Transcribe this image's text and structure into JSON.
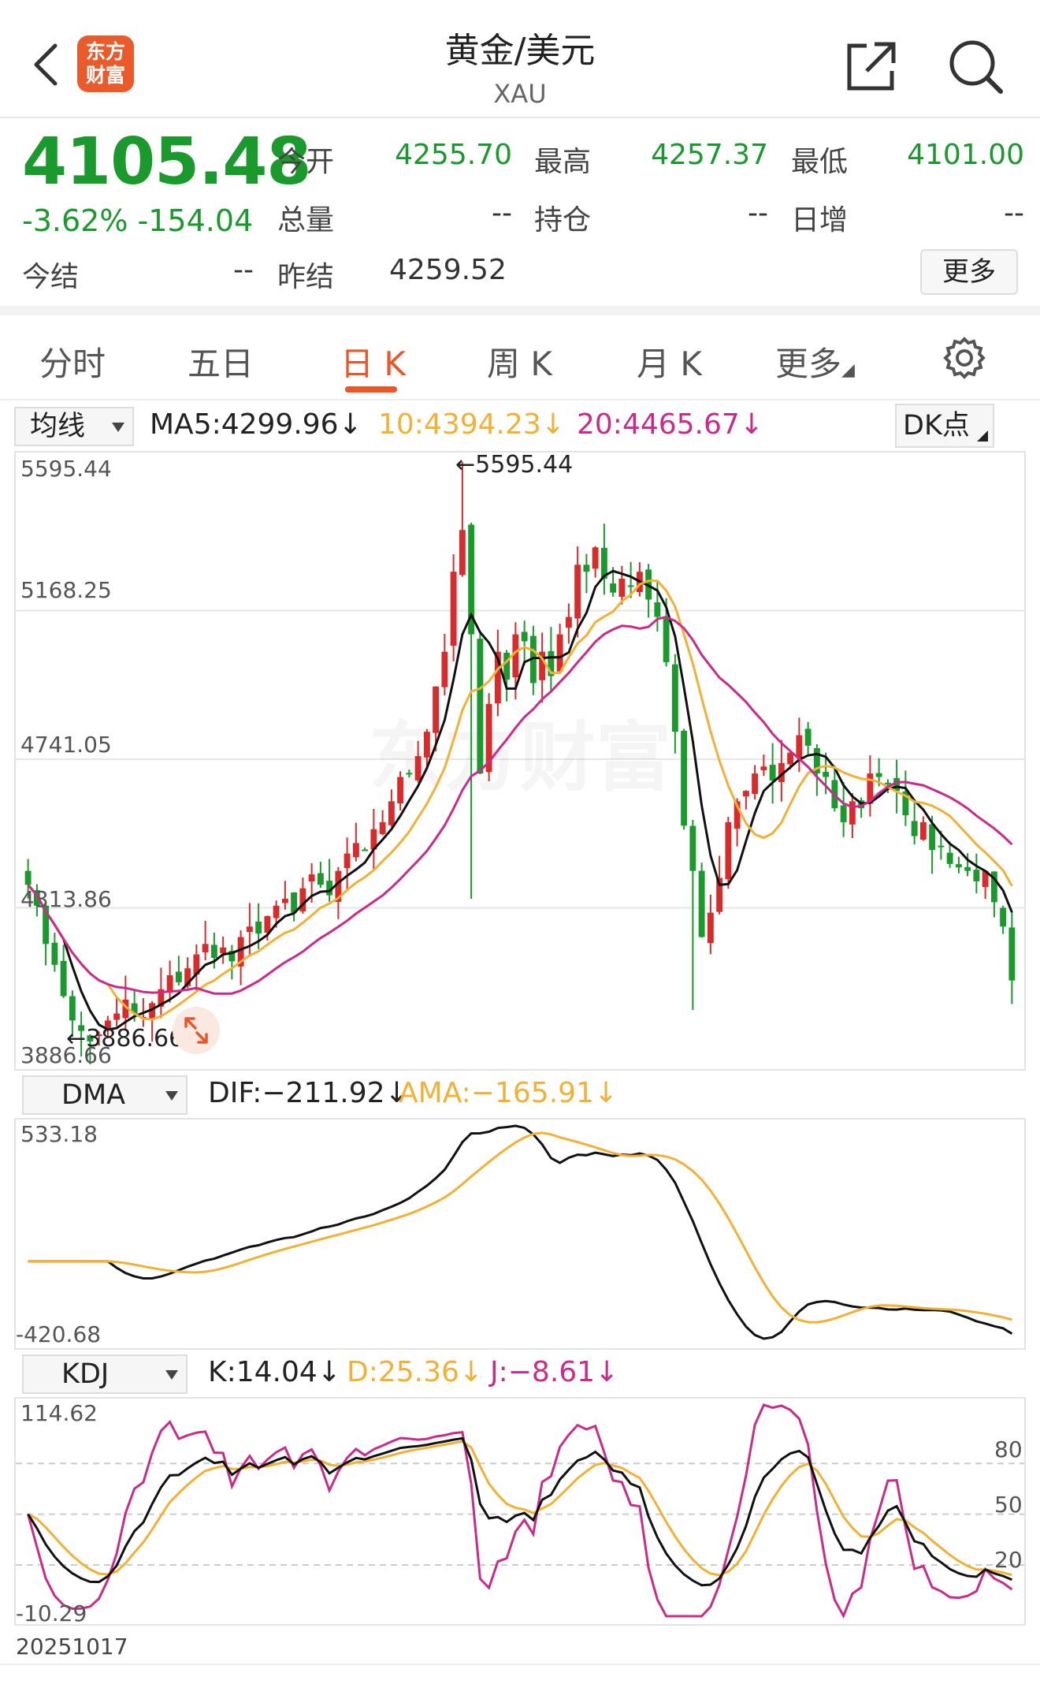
{
  "header": {
    "title": "黄金/美元",
    "subtitle": "XAU",
    "logo_text_1": "东方",
    "logo_text_2": "财富"
  },
  "quote": {
    "price": "4105.48",
    "change_pct": "-3.62%",
    "change_abs": "-154.04",
    "open_label": "今开",
    "open": "4255.70",
    "high_label": "最高",
    "high": "4257.37",
    "low_label": "最低",
    "low": "4101.00",
    "volume_label": "总量",
    "volume": "--",
    "position_label": "持仓",
    "position": "--",
    "daily_inc_label": "日增",
    "daily_inc": "--",
    "settle_label": "今结",
    "settle": "--",
    "prev_settle_label": "昨结",
    "prev_settle": "4259.52",
    "more_label": "更多"
  },
  "tabs": [
    {
      "label": "分时"
    },
    {
      "label": "五日"
    },
    {
      "label": "日 K"
    },
    {
      "label": "周 K"
    },
    {
      "label": "月 K"
    },
    {
      "label": "更多"
    }
  ],
  "active_tab": "日 K",
  "ma_bar": {
    "selector": "均线",
    "ma5": "MA5:4299.96",
    "ma10": "10:4394.23",
    "ma20": "20:4465.67",
    "dk_label": "DK点"
  },
  "price_axis": {
    "top": "5595.44",
    "l2": "5168.25",
    "l3": "4741.05",
    "l4": "4313.86",
    "bottom": "3886.66",
    "max_marker": "5595.44",
    "min_marker": "3886.66"
  },
  "dma_bar": {
    "selector": "DMA",
    "dif": "DIF:−211.92",
    "ama": "AMA:−165.91",
    "top": "533.18",
    "bottom": "-420.68"
  },
  "kdj_bar": {
    "selector": "KDJ",
    "k": "K:14.04",
    "d": "D:25.36",
    "j": "J:−8.61",
    "top": "114.62",
    "bottom": "-10.29",
    "lvl80": "80",
    "lvl50": "50",
    "lvl20": "20"
  },
  "date_label": "20251017",
  "watermark": "东方财富",
  "colors": {
    "down": "#1a9a2c",
    "up": "#d92b2b",
    "accent": "#e8562a",
    "ma5": "#111111",
    "ma10": "#f2b134",
    "ma20": "#cc2a8a"
  },
  "chart_data": {
    "type": "candlestick",
    "ylim": [
      3886.66,
      5595.44
    ],
    "close_series": [
      4380,
      4320,
      4210,
      4150,
      4060,
      3990,
      3960,
      3930,
      3950,
      3990,
      4010,
      4050,
      4010,
      4000,
      4040,
      4080,
      4120,
      4100,
      4140,
      4180,
      4210,
      4170,
      4200,
      4160,
      4230,
      4260,
      4240,
      4290,
      4320,
      4340,
      4300,
      4370,
      4410,
      4380,
      4350,
      4420,
      4470,
      4500,
      4480,
      4540,
      4560,
      4620,
      4690,
      4700,
      4750,
      4820,
      4950,
      5050,
      5280,
      5400,
      5100,
      4700,
      4900,
      5050,
      4970,
      5100,
      5080,
      4960,
      5050,
      4980,
      5100,
      5150,
      5300,
      5280,
      5350,
      5260,
      5220,
      5260,
      5240,
      5280,
      5200,
      5150,
      5020,
      4820,
      4550,
      4420,
      4230,
      4300,
      4400,
      4560,
      4620,
      4650,
      4700,
      4720,
      4680,
      4730,
      4760,
      4810,
      4780,
      4700,
      4690,
      4600,
      4560,
      4620,
      4600,
      4700,
      4690,
      4670,
      4650,
      4580,
      4520,
      4560,
      4480,
      4490,
      4440,
      4430,
      4420,
      4390,
      4420,
      4330,
      4260,
      4105
    ],
    "ma5_last": 4299.96,
    "ma10_last": 4394.23,
    "ma20_last": 4465.67,
    "max": 5595.44,
    "min": 3886.66
  }
}
